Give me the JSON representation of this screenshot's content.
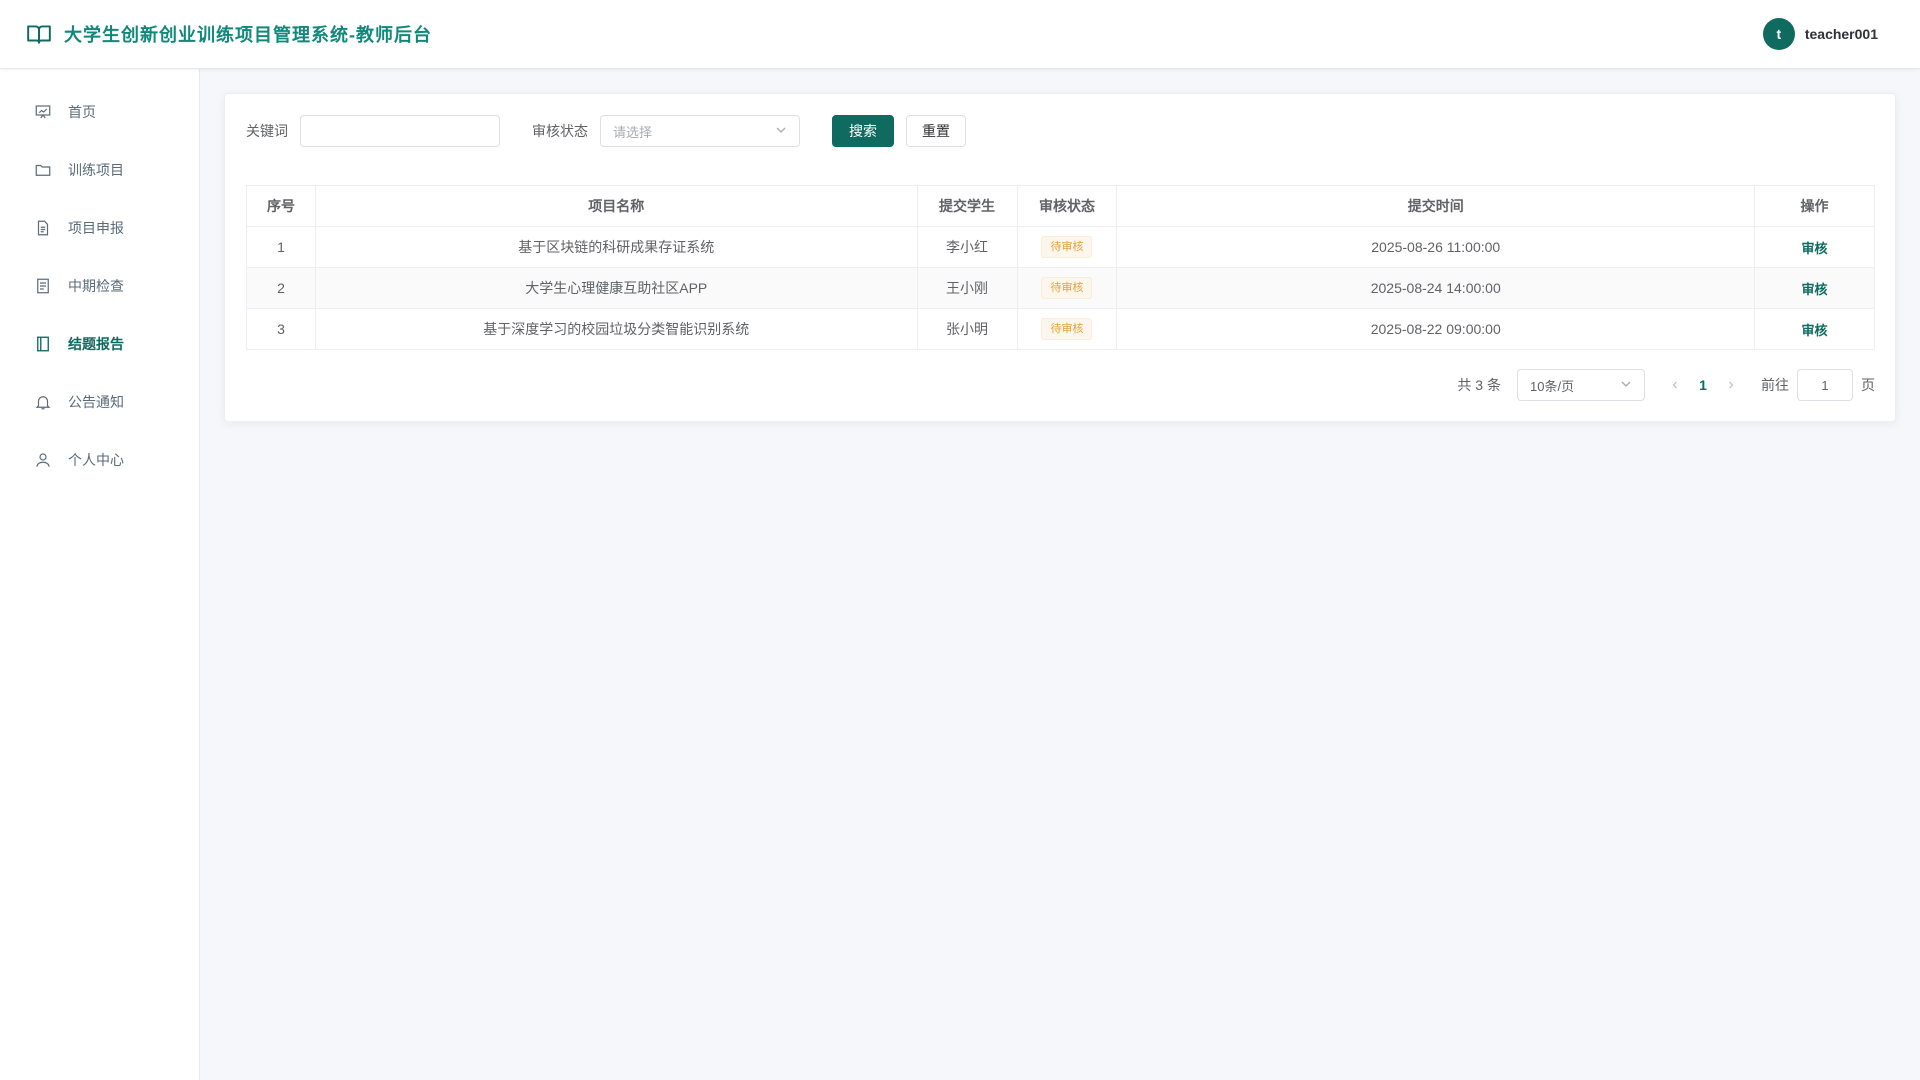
{
  "header": {
    "title": "大学生创新创业训练项目管理系统-教师后台",
    "avatar_letter": "t",
    "username": "teacher001"
  },
  "sidebar": {
    "items": [
      {
        "label": "首页",
        "icon": "presentation-icon",
        "active": false
      },
      {
        "label": "训练项目",
        "icon": "folder-icon",
        "active": false
      },
      {
        "label": "项目申报",
        "icon": "document-icon",
        "active": false
      },
      {
        "label": "中期检查",
        "icon": "checklist-icon",
        "active": false
      },
      {
        "label": "结题报告",
        "icon": "notebook-icon",
        "active": true
      },
      {
        "label": "公告通知",
        "icon": "bell-icon",
        "active": false
      },
      {
        "label": "个人中心",
        "icon": "user-icon",
        "active": false
      }
    ]
  },
  "filter": {
    "keyword_label": "关键词",
    "keyword_value": "",
    "status_label": "审核状态",
    "status_placeholder": "请选择",
    "search_label": "搜索",
    "reset_label": "重置"
  },
  "table": {
    "columns": [
      "序号",
      "项目名称",
      "提交学生",
      "审核状态",
      "提交时间",
      "操作"
    ],
    "rows": [
      {
        "index": "1",
        "name": "基于区块链的科研成果存证系统",
        "student": "李小红",
        "status": "待审核",
        "time": "2025-08-26 11:00:00",
        "action": "审核"
      },
      {
        "index": "2",
        "name": "大学生心理健康互助社区APP",
        "student": "王小刚",
        "status": "待审核",
        "time": "2025-08-24 14:00:00",
        "action": "审核"
      },
      {
        "index": "3",
        "name": "基于深度学习的校园垃圾分类智能识别系统",
        "student": "张小明",
        "status": "待审核",
        "time": "2025-08-22 09:00:00",
        "action": "审核"
      }
    ]
  },
  "pagination": {
    "total_text": "共 3 条",
    "page_size": "10条/页",
    "current_page": "1",
    "goto_label": "前往",
    "goto_value": "1",
    "page_suffix": "页"
  },
  "colors": {
    "primary": "#0f6b60",
    "title": "#11897a",
    "warning_tag": "#e6a23c"
  }
}
